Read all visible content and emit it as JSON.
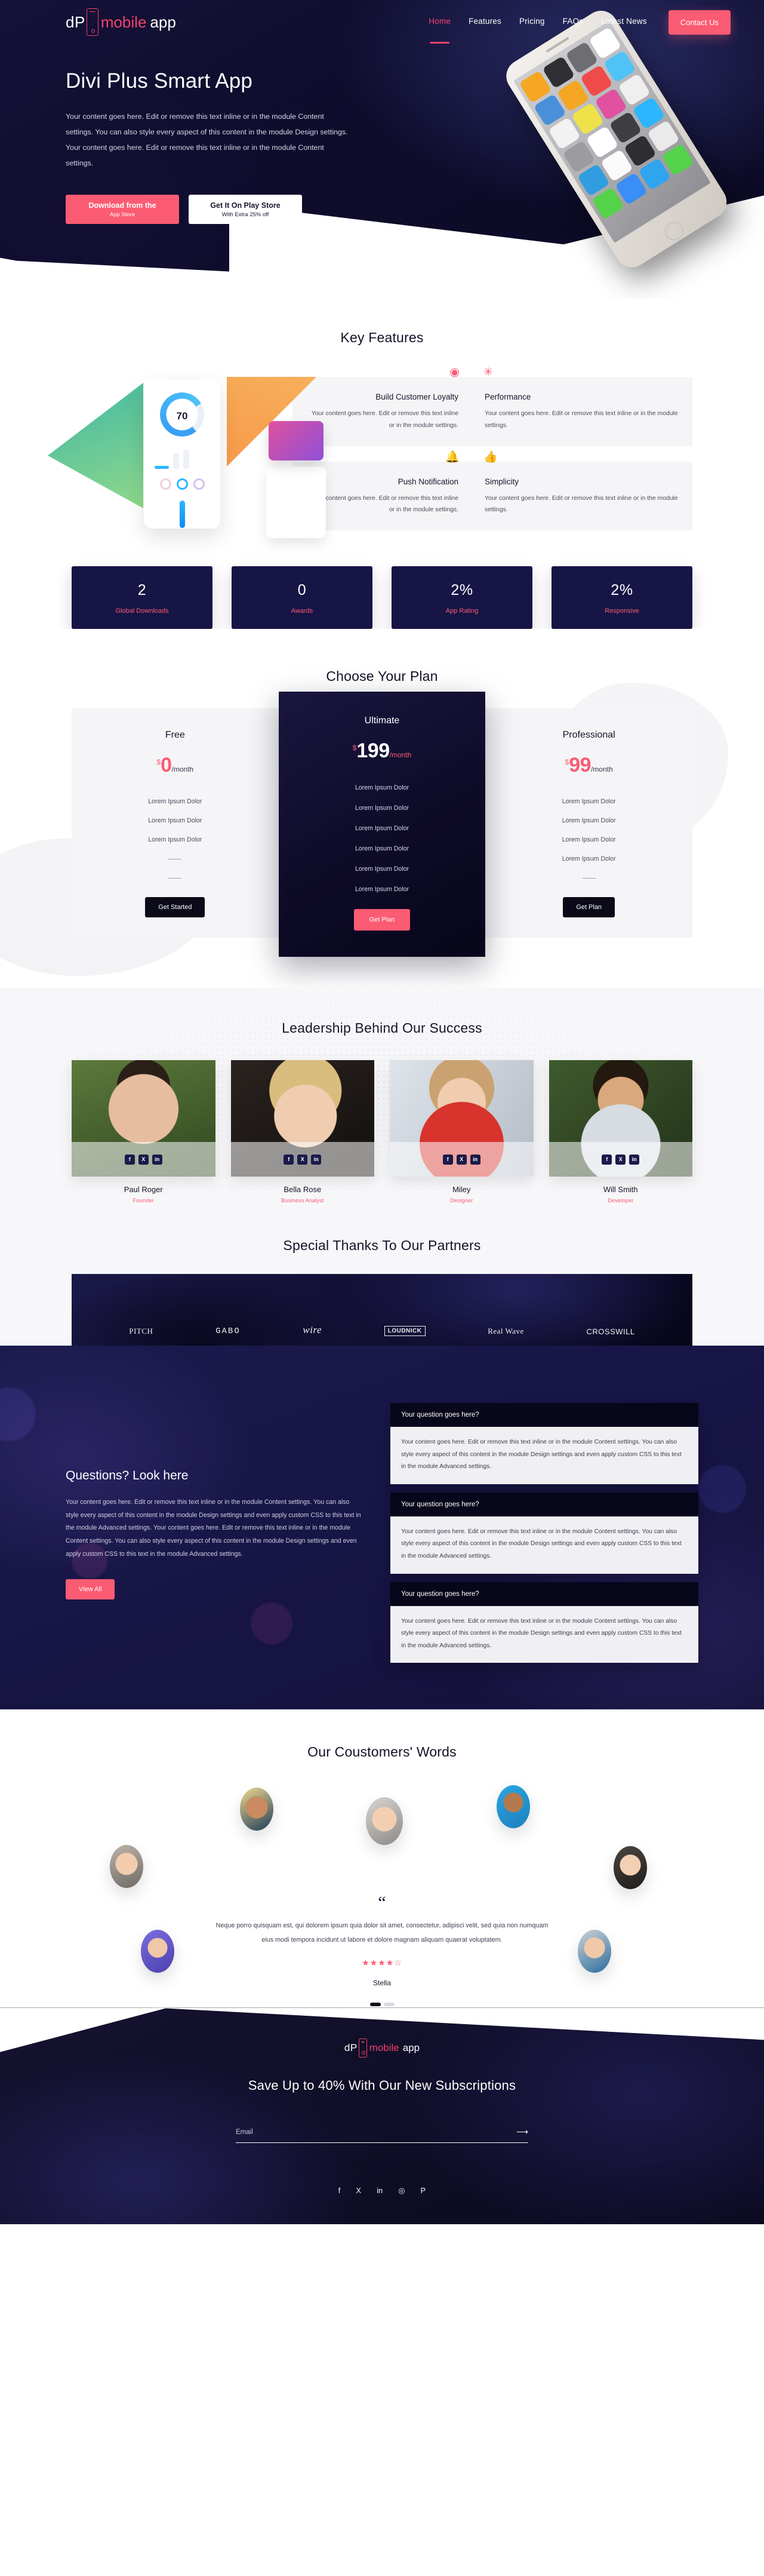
{
  "brand": {
    "dp": "dP",
    "mobile": "mobile",
    "app": "app"
  },
  "nav": {
    "items": [
      {
        "label": "Home",
        "active": true
      },
      {
        "label": "Features",
        "active": false
      },
      {
        "label": "Pricing",
        "active": false
      },
      {
        "label": "FAQs",
        "active": false
      },
      {
        "label": "Latest News",
        "active": false
      }
    ],
    "cta": "Contact Us",
    "accent": "#fb5b73"
  },
  "hero": {
    "title": "Divi Plus Smart App",
    "desc": "Your content goes here. Edit or remove this text inline or in the module Content settings. You can also style every aspect of this content in the module Design settings. Your content goes here. Edit or remove this text inline or in the module Content settings.",
    "btn_primary_l1": "Download from the",
    "btn_primary_l2": "App Store",
    "btn_secondary_l1": "Get It On Play Store",
    "btn_secondary_l2": "With Extra 25% off"
  },
  "features": {
    "title": "Key Features",
    "mock_gauge_value": "70",
    "left": [
      {
        "icon": "lifebuoy-icon",
        "glyph": "◉",
        "title": "Build Customer Loyalty",
        "desc": "Your content goes here. Edit or remove this text inline or in the module settings."
      },
      {
        "icon": "bell-icon",
        "glyph": "🔔",
        "title": "Push Notification",
        "desc": "Your content goes here. Edit or remove this text inline or in the module settings."
      }
    ],
    "right": [
      {
        "icon": "atom-icon",
        "glyph": "✳",
        "title": "Performance",
        "desc": "Your content goes here. Edit or remove this text inline or in the module settings."
      },
      {
        "icon": "thumbs-up-icon",
        "glyph": "👍",
        "title": "Simplicity",
        "desc": "Your content goes here. Edit or remove this text inline or in the module settings."
      }
    ]
  },
  "counters": [
    {
      "num": "2",
      "label": "Global Downloads"
    },
    {
      "num": "0",
      "label": "Awards"
    },
    {
      "num": "2%",
      "label": "App Rating"
    },
    {
      "num": "2%",
      "label": "Responsive"
    }
  ],
  "pricing": {
    "title": "Choose Your Plan",
    "plans": [
      {
        "name": "Free",
        "currency": "$",
        "price": "0",
        "period": "/month",
        "features": [
          "Lorem Ipsum Dolor",
          "Lorem Ipsum Dolor",
          "Lorem Ipsum Dolor",
          "",
          ""
        ],
        "button": "Get Started",
        "featured": false
      },
      {
        "name": "Ultimate",
        "currency": "$",
        "price": "199",
        "period": "/month",
        "features": [
          "Lorem Ipsum Dolor",
          "Lorem Ipsum Dolor",
          "Lorem Ipsum Dolor",
          "Lorem Ipsum Dolor",
          "Lorem Ipsum Dolor",
          "Lorem Ipsum Dolor"
        ],
        "button": "Get Plan",
        "featured": true
      },
      {
        "name": "Professional",
        "currency": "$",
        "price": "99",
        "period": "/month",
        "features": [
          "Lorem Ipsum Dolor",
          "Lorem Ipsum Dolor",
          "Lorem Ipsum Dolor",
          "Lorem Ipsum Dolor",
          ""
        ],
        "button": "Get Plan",
        "featured": false
      }
    ]
  },
  "team": {
    "title": "Leadership Behind Our Success",
    "socials": [
      "f",
      "X",
      "in"
    ],
    "members": [
      {
        "name": "Paul Roger",
        "role": "Founder"
      },
      {
        "name": "Bella Rose",
        "role": "Business Analyst"
      },
      {
        "name": "Miley",
        "role": "Designer"
      },
      {
        "name": "Will Smith",
        "role": "Developer"
      }
    ]
  },
  "partners": {
    "title": "Special Thanks To Our Partners",
    "logos": [
      "PITCH",
      "GABO",
      "wire",
      "LOUDNICK",
      "Real Wave",
      "CROSSWILL"
    ]
  },
  "faq": {
    "heading": "Questions? Look here",
    "desc": "Your content goes here. Edit or remove this text inline or in the module Content settings. You can also style every aspect of this content in the module Design settings and even apply custom CSS to this text in the module Advanced settings. Your content goes here. Edit or remove this text inline or in the module Content settings. You can also style every aspect of this content in the module Design settings and even apply custom CSS to this text in the module Advanced settings.",
    "button": "View All",
    "items": [
      {
        "q": "Your question goes here?",
        "a": "Your content goes here. Edit or remove this text inline or in the module Content settings. You can also style every aspect of this content in the module Design settings and even apply custom CSS to this text in the module Advanced settings."
      },
      {
        "q": "Your question goes here?",
        "a": "Your content goes here. Edit or remove this text inline or in the module Content settings. You can also style every aspect of this content in the module Design settings and even apply custom CSS to this text in the module Advanced settings."
      },
      {
        "q": "Your question goes here?",
        "a": "Your content goes here. Edit or remove this text inline or in the module Content settings. You can also style every aspect of this content in the module Design settings and even apply custom CSS to this text in the module Advanced settings."
      }
    ]
  },
  "testimonials": {
    "title": "Our Coustomers' Words",
    "quote_mark": "“",
    "quote": "Neque porro quisquam est, qui dolorem ipsum quia dolor sit amet, consectetur, adipisci velit, sed quia non numquam eius modi tempora incidunt ut labore et dolore magnam aliquam quaerat voluptatem.",
    "rating": "★★★★☆",
    "author": "Stella",
    "slides": 2,
    "active_slide": 1
  },
  "footer": {
    "heading": "Save Up to 40% With Our New Subscriptions",
    "email_placeholder": "Email",
    "email_value": "",
    "submit_glyph": "⟶",
    "socials": [
      "f",
      "X",
      "in",
      "◎",
      "P"
    ]
  }
}
